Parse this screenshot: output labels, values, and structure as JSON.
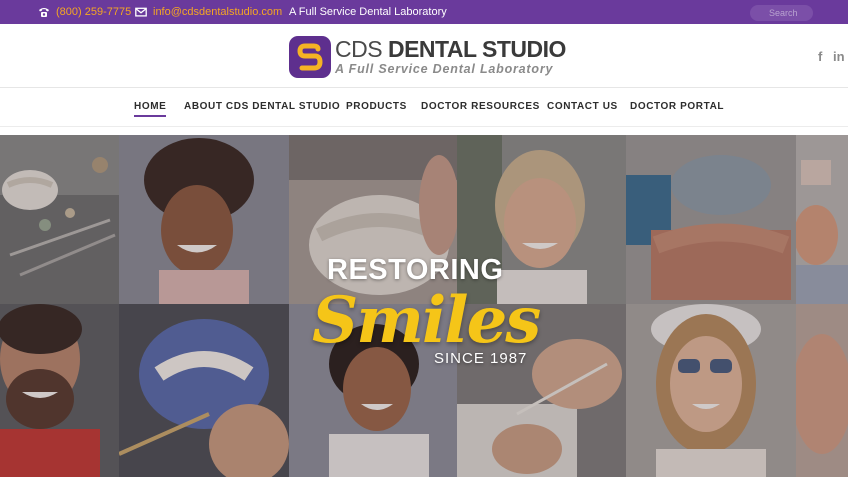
{
  "topbar": {
    "phone": "(800) 259-7775",
    "email": "info@cdsdentalstudio.com",
    "tagline": "A Full Service Dental Laboratory",
    "search_placeholder": "Search"
  },
  "header": {
    "logo_light": "CDS ",
    "logo_bold": "DENTAL STUDIO",
    "logo_subtitle": "A Full Service Dental Laboratory",
    "social": [
      "f",
      "in"
    ]
  },
  "nav": {
    "items": [
      {
        "label": "HOME",
        "active": true
      },
      {
        "label": "ABOUT CDS DENTAL STUDIO"
      },
      {
        "label": "PRODUCTS"
      },
      {
        "label": "DOCTOR RESOURCES"
      },
      {
        "label": "CONTACT US"
      },
      {
        "label": "DOCTOR PORTAL"
      }
    ]
  },
  "hero": {
    "line1": "RESTORING",
    "line2": "Smiles",
    "line3": "SINCE 1987"
  },
  "colors": {
    "brand_purple": "#6a3a9c",
    "accent_orange": "#f5a623",
    "hero_yellow": "#f5c518"
  }
}
